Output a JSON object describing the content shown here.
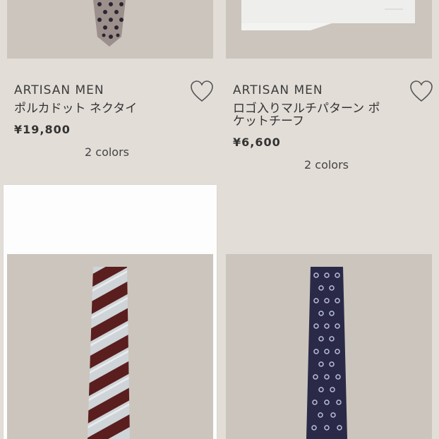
{
  "products": [
    {
      "brand": "ARTISAN MEN",
      "name": "ポルカドット ネクタイ",
      "price": "¥19,800",
      "colors": "2  colors"
    },
    {
      "brand": "ARTISAN MEN",
      "name": "ロゴ入りマルチパターン ポ",
      "name_line2": "ケットチーフ",
      "price": "¥6,600",
      "colors": "2  colors"
    },
    {
      "image": "striped-necktie"
    },
    {
      "image": "ring-pattern-navy-necktie"
    }
  ],
  "icons": {
    "favorite": "heart-outline-icon"
  },
  "colors": {
    "background": "#e2ddd7",
    "photo_bg": "#cbc5bd"
  }
}
